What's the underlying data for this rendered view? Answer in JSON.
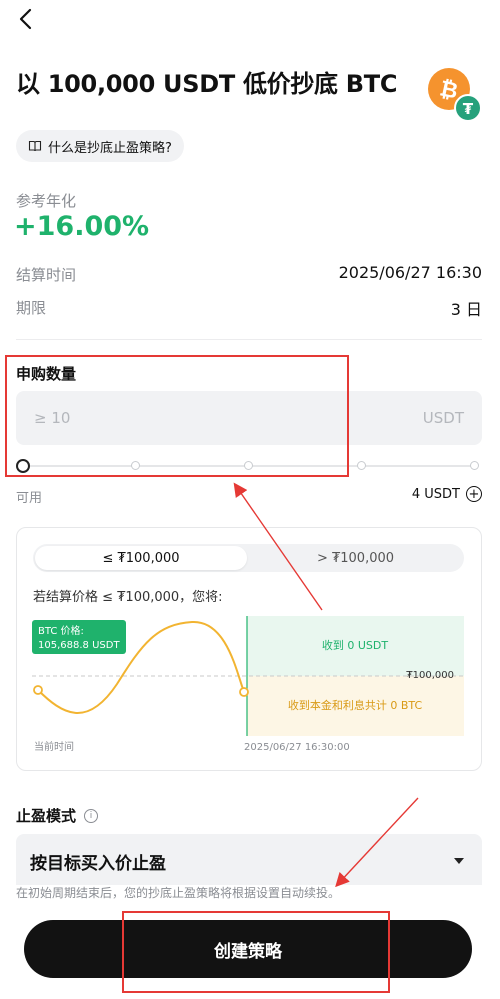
{
  "header": {
    "title": "以 100,000 USDT 低价抄底 BTC",
    "coins": [
      "BTC",
      "USDT"
    ]
  },
  "faq": {
    "label": "什么是抄底止盈策略?"
  },
  "apr": {
    "label": "参考年化",
    "value": "+16.00%"
  },
  "settlement": {
    "label": "结算时间",
    "value": "2025/06/27 16:30"
  },
  "term": {
    "label": "期限",
    "value": "3 日"
  },
  "subscribe": {
    "title": "申购数量",
    "placeholder": "≥ 10",
    "unit": "USDT",
    "slider_level": 0
  },
  "available": {
    "label": "可用",
    "value": "4 USDT"
  },
  "scenario": {
    "tabs": [
      {
        "label": "≤ ₮100,000",
        "active": true
      },
      {
        "label": "> ₮100,000",
        "active": false
      }
    ],
    "text": "若结算价格 ≤ ₮100,000，您将:",
    "btc_price_label": "BTC 价格:",
    "btc_price_value": "105,688.8 USDT",
    "upper_zone": "收到 0 USDT",
    "lower_zone": "收到本金和利息共计 0 BTC",
    "strike_label": "₮100,000",
    "now_label": "当前时间",
    "settle_label": "2025/06/27 16:30:00"
  },
  "take_profit": {
    "label": "止盈模式",
    "selected": "按目标买入价止盈",
    "note": "在初始周期结束后，您的抄底止盈策略将根据设置自动续投。"
  },
  "cta": {
    "label": "创建策略"
  },
  "colors": {
    "accent_green": "#1fb26c",
    "annotation_red": "#e53935",
    "btc_orange": "#f5932e",
    "usdt_green": "#26a17b",
    "chart_line": "#f2b431"
  }
}
